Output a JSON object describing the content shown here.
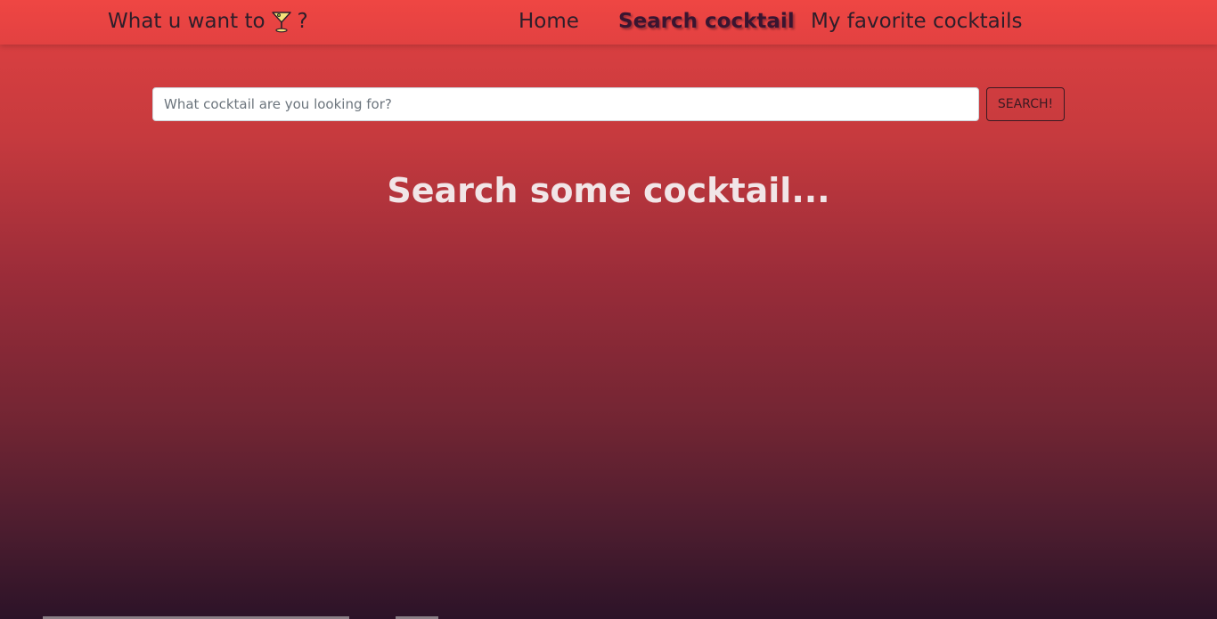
{
  "navbar": {
    "brand_text": "What u want to",
    "brand_suffix": "?",
    "brand_icon": "cocktail-glass-icon",
    "links": {
      "home": "Home",
      "search": "Search cocktail",
      "favorites": "My favorite cocktails"
    },
    "active_link": "search"
  },
  "search": {
    "placeholder": "What cocktail are you looking for?",
    "value": "",
    "button_label": "SEARCH!"
  },
  "main": {
    "heading": "Search some cocktail..."
  },
  "colors": {
    "navbar": "#e24141",
    "gradient_top": "#e14141",
    "gradient_bottom": "#2c1328",
    "nav_text": "#2d1e2a",
    "heading_text": "#f1e5e7"
  }
}
